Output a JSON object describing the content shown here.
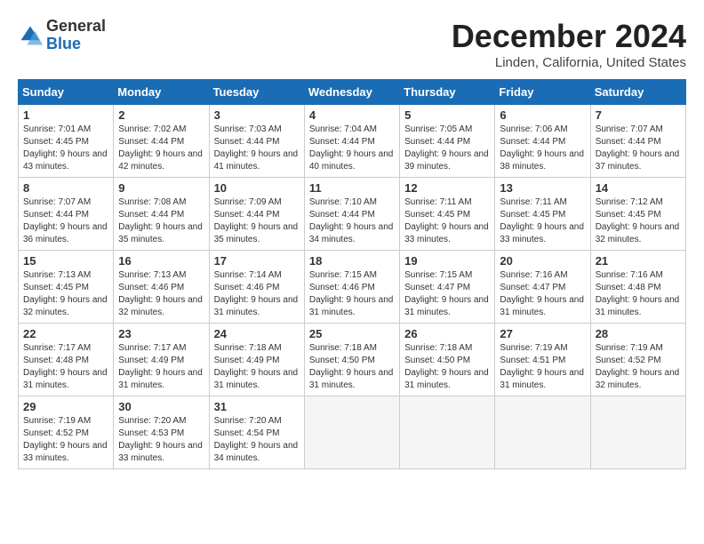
{
  "header": {
    "logo_general": "General",
    "logo_blue": "Blue",
    "month_title": "December 2024",
    "location": "Linden, California, United States"
  },
  "days_of_week": [
    "Sunday",
    "Monday",
    "Tuesday",
    "Wednesday",
    "Thursday",
    "Friday",
    "Saturday"
  ],
  "weeks": [
    [
      {
        "day": "1",
        "sunrise": "Sunrise: 7:01 AM",
        "sunset": "Sunset: 4:45 PM",
        "daylight": "Daylight: 9 hours and 43 minutes."
      },
      {
        "day": "2",
        "sunrise": "Sunrise: 7:02 AM",
        "sunset": "Sunset: 4:44 PM",
        "daylight": "Daylight: 9 hours and 42 minutes."
      },
      {
        "day": "3",
        "sunrise": "Sunrise: 7:03 AM",
        "sunset": "Sunset: 4:44 PM",
        "daylight": "Daylight: 9 hours and 41 minutes."
      },
      {
        "day": "4",
        "sunrise": "Sunrise: 7:04 AM",
        "sunset": "Sunset: 4:44 PM",
        "daylight": "Daylight: 9 hours and 40 minutes."
      },
      {
        "day": "5",
        "sunrise": "Sunrise: 7:05 AM",
        "sunset": "Sunset: 4:44 PM",
        "daylight": "Daylight: 9 hours and 39 minutes."
      },
      {
        "day": "6",
        "sunrise": "Sunrise: 7:06 AM",
        "sunset": "Sunset: 4:44 PM",
        "daylight": "Daylight: 9 hours and 38 minutes."
      },
      {
        "day": "7",
        "sunrise": "Sunrise: 7:07 AM",
        "sunset": "Sunset: 4:44 PM",
        "daylight": "Daylight: 9 hours and 37 minutes."
      }
    ],
    [
      {
        "day": "8",
        "sunrise": "Sunrise: 7:07 AM",
        "sunset": "Sunset: 4:44 PM",
        "daylight": "Daylight: 9 hours and 36 minutes."
      },
      {
        "day": "9",
        "sunrise": "Sunrise: 7:08 AM",
        "sunset": "Sunset: 4:44 PM",
        "daylight": "Daylight: 9 hours and 35 minutes."
      },
      {
        "day": "10",
        "sunrise": "Sunrise: 7:09 AM",
        "sunset": "Sunset: 4:44 PM",
        "daylight": "Daylight: 9 hours and 35 minutes."
      },
      {
        "day": "11",
        "sunrise": "Sunrise: 7:10 AM",
        "sunset": "Sunset: 4:44 PM",
        "daylight": "Daylight: 9 hours and 34 minutes."
      },
      {
        "day": "12",
        "sunrise": "Sunrise: 7:11 AM",
        "sunset": "Sunset: 4:45 PM",
        "daylight": "Daylight: 9 hours and 33 minutes."
      },
      {
        "day": "13",
        "sunrise": "Sunrise: 7:11 AM",
        "sunset": "Sunset: 4:45 PM",
        "daylight": "Daylight: 9 hours and 33 minutes."
      },
      {
        "day": "14",
        "sunrise": "Sunrise: 7:12 AM",
        "sunset": "Sunset: 4:45 PM",
        "daylight": "Daylight: 9 hours and 32 minutes."
      }
    ],
    [
      {
        "day": "15",
        "sunrise": "Sunrise: 7:13 AM",
        "sunset": "Sunset: 4:45 PM",
        "daylight": "Daylight: 9 hours and 32 minutes."
      },
      {
        "day": "16",
        "sunrise": "Sunrise: 7:13 AM",
        "sunset": "Sunset: 4:46 PM",
        "daylight": "Daylight: 9 hours and 32 minutes."
      },
      {
        "day": "17",
        "sunrise": "Sunrise: 7:14 AM",
        "sunset": "Sunset: 4:46 PM",
        "daylight": "Daylight: 9 hours and 31 minutes."
      },
      {
        "day": "18",
        "sunrise": "Sunrise: 7:15 AM",
        "sunset": "Sunset: 4:46 PM",
        "daylight": "Daylight: 9 hours and 31 minutes."
      },
      {
        "day": "19",
        "sunrise": "Sunrise: 7:15 AM",
        "sunset": "Sunset: 4:47 PM",
        "daylight": "Daylight: 9 hours and 31 minutes."
      },
      {
        "day": "20",
        "sunrise": "Sunrise: 7:16 AM",
        "sunset": "Sunset: 4:47 PM",
        "daylight": "Daylight: 9 hours and 31 minutes."
      },
      {
        "day": "21",
        "sunrise": "Sunrise: 7:16 AM",
        "sunset": "Sunset: 4:48 PM",
        "daylight": "Daylight: 9 hours and 31 minutes."
      }
    ],
    [
      {
        "day": "22",
        "sunrise": "Sunrise: 7:17 AM",
        "sunset": "Sunset: 4:48 PM",
        "daylight": "Daylight: 9 hours and 31 minutes."
      },
      {
        "day": "23",
        "sunrise": "Sunrise: 7:17 AM",
        "sunset": "Sunset: 4:49 PM",
        "daylight": "Daylight: 9 hours and 31 minutes."
      },
      {
        "day": "24",
        "sunrise": "Sunrise: 7:18 AM",
        "sunset": "Sunset: 4:49 PM",
        "daylight": "Daylight: 9 hours and 31 minutes."
      },
      {
        "day": "25",
        "sunrise": "Sunrise: 7:18 AM",
        "sunset": "Sunset: 4:50 PM",
        "daylight": "Daylight: 9 hours and 31 minutes."
      },
      {
        "day": "26",
        "sunrise": "Sunrise: 7:18 AM",
        "sunset": "Sunset: 4:50 PM",
        "daylight": "Daylight: 9 hours and 31 minutes."
      },
      {
        "day": "27",
        "sunrise": "Sunrise: 7:19 AM",
        "sunset": "Sunset: 4:51 PM",
        "daylight": "Daylight: 9 hours and 31 minutes."
      },
      {
        "day": "28",
        "sunrise": "Sunrise: 7:19 AM",
        "sunset": "Sunset: 4:52 PM",
        "daylight": "Daylight: 9 hours and 32 minutes."
      }
    ],
    [
      {
        "day": "29",
        "sunrise": "Sunrise: 7:19 AM",
        "sunset": "Sunset: 4:52 PM",
        "daylight": "Daylight: 9 hours and 33 minutes."
      },
      {
        "day": "30",
        "sunrise": "Sunrise: 7:20 AM",
        "sunset": "Sunset: 4:53 PM",
        "daylight": "Daylight: 9 hours and 33 minutes."
      },
      {
        "day": "31",
        "sunrise": "Sunrise: 7:20 AM",
        "sunset": "Sunset: 4:54 PM",
        "daylight": "Daylight: 9 hours and 34 minutes."
      },
      null,
      null,
      null,
      null
    ]
  ]
}
